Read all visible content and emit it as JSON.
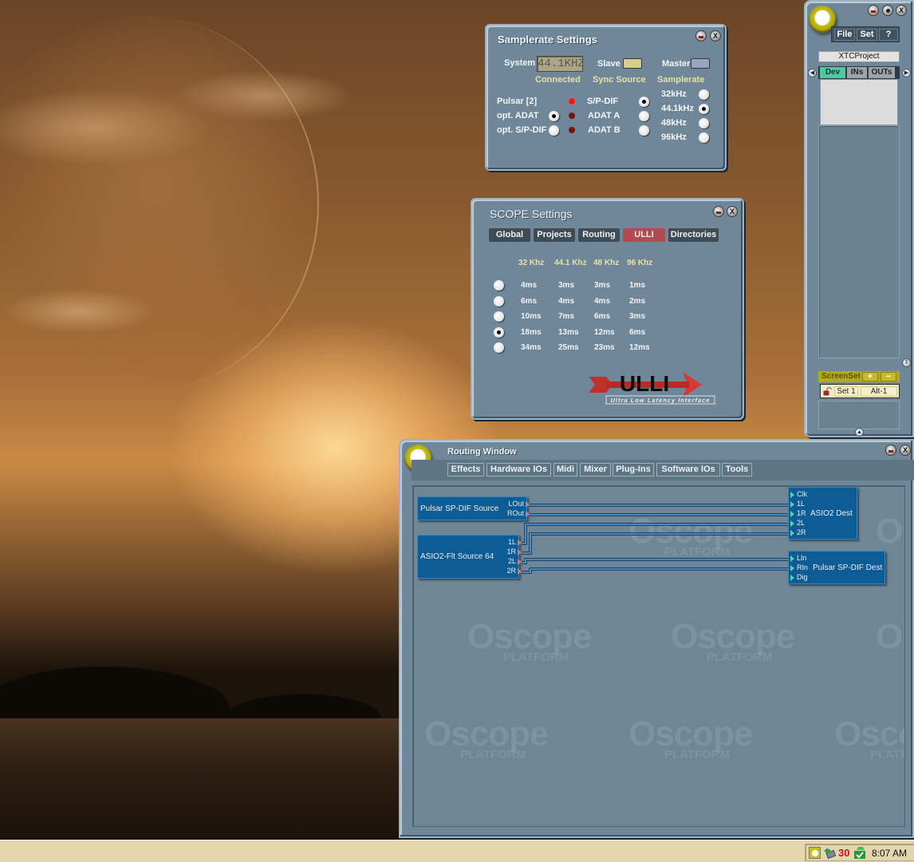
{
  "samplerate_window": {
    "title": "Samplerate Settings",
    "system_label": "System",
    "lcd_value": "44.1KHZ",
    "slave_label": "Slave",
    "master_label": "Master",
    "headers": {
      "connected": "Connected",
      "sync_source": "Sync Source",
      "samplerate": "Samplerate"
    },
    "connected_items": [
      {
        "label": "Pulsar [2]",
        "led": "on",
        "selected": null
      },
      {
        "label": "opt. ADAT",
        "led": "off",
        "selected": true
      },
      {
        "label": "opt. S/P-DIF",
        "led": "off",
        "selected": false
      }
    ],
    "sync_sources": [
      {
        "label": "S/P-DIF",
        "selected": true
      },
      {
        "label": "ADAT A",
        "selected": false
      },
      {
        "label": "ADAT B",
        "selected": false
      }
    ],
    "samplerates": [
      {
        "label": "32kHz",
        "selected": false
      },
      {
        "label": "44.1kHz",
        "selected": true
      },
      {
        "label": "48kHz",
        "selected": false
      },
      {
        "label": "96kHz",
        "selected": false
      }
    ],
    "colors": {
      "led_on": "#e51c1c",
      "led_off": "#7a1010",
      "slave_button": "#d9cc8c",
      "master_button": "#9aa3c0"
    }
  },
  "scope_window": {
    "title": "SCOPE Settings",
    "tabs": [
      {
        "label": "Global",
        "active": false
      },
      {
        "label": "Projects",
        "active": false
      },
      {
        "label": "Routing",
        "active": false
      },
      {
        "label": "ULLI",
        "active": true
      },
      {
        "label": "Directories",
        "active": false
      }
    ],
    "latency_headers": [
      "32 Khz",
      "44.1 Khz",
      "48 Khz",
      "96 Khz"
    ],
    "latency_rows": [
      {
        "values": [
          "4ms",
          "3ms",
          "3ms",
          "1ms"
        ],
        "selected": false
      },
      {
        "values": [
          "6ms",
          "4ms",
          "4ms",
          "2ms"
        ],
        "selected": false
      },
      {
        "values": [
          "10ms",
          "7ms",
          "6ms",
          "3ms"
        ],
        "selected": false
      },
      {
        "values": [
          "18ms",
          "13ms",
          "12ms",
          "6ms"
        ],
        "selected": true
      },
      {
        "values": [
          "34ms",
          "25ms",
          "23ms",
          "12ms"
        ],
        "selected": false
      }
    ],
    "logo_text": "ULLI",
    "logo_subtitle": "Ultra Low Latency Interface"
  },
  "project_panel": {
    "menu": [
      "File",
      "Set",
      "?"
    ],
    "project_name": "XTCProject",
    "tabs": [
      {
        "label": "Dev",
        "active": true
      },
      {
        "label": "INs",
        "active": false
      },
      {
        "label": "OUTs",
        "active": false
      }
    ],
    "screensets": {
      "label": "ScreenSets",
      "add": "+",
      "remove": "−",
      "rows": [
        {
          "name": "Set 1",
          "shortcut": "Alt-1",
          "locked": false
        }
      ]
    }
  },
  "routing_window": {
    "title": "Routing Window",
    "menu": [
      "Effects",
      "Hardware IOs",
      "Midi",
      "Mixer",
      "Plug-Ins",
      "Software IOs",
      "Tools"
    ],
    "watermark": {
      "brand": "scope",
      "sub": "PLATFORM",
      "tm": "™"
    },
    "modules": [
      {
        "name": "Pulsar SP-DIF Source",
        "outputs": [
          "LOut",
          "ROut"
        ],
        "inputs": []
      },
      {
        "name": "ASIO2-Flt Source 64",
        "outputs": [
          "1L",
          "1R",
          "2L",
          "2R"
        ],
        "inputs": []
      },
      {
        "name": "ASIO2 Dest",
        "outputs": [],
        "inputs": [
          "Clk",
          "1L",
          "1R",
          "2L",
          "2R"
        ]
      },
      {
        "name": "Pulsar SP-DIF Dest",
        "outputs": [],
        "inputs": [
          "LIn",
          "RIn",
          "Dig"
        ]
      }
    ],
    "connections": [
      {
        "from": "Pulsar SP-DIF Source.LOut",
        "to": "ASIO2 Dest.1L"
      },
      {
        "from": "Pulsar SP-DIF Source.ROut",
        "to": "ASIO2 Dest.1R"
      },
      {
        "from": "ASIO2-Flt Source 64.1L",
        "to": "ASIO2 Dest.2L"
      },
      {
        "from": "ASIO2-Flt Source 64.1R",
        "to": "ASIO2 Dest.2R"
      },
      {
        "from": "ASIO2-Flt Source 64.2L",
        "to": "Pulsar SP-DIF Dest.LIn"
      },
      {
        "from": "ASIO2-Flt Source 64.2R",
        "to": "Pulsar SP-DIF Dest.RIn"
      }
    ]
  },
  "taskbar": {
    "tray_icons": [
      "scope-tray-icon",
      "network-tray-icon",
      "green-check-tray-icon"
    ],
    "tray_count": "30",
    "clock": "8:07 AM"
  }
}
